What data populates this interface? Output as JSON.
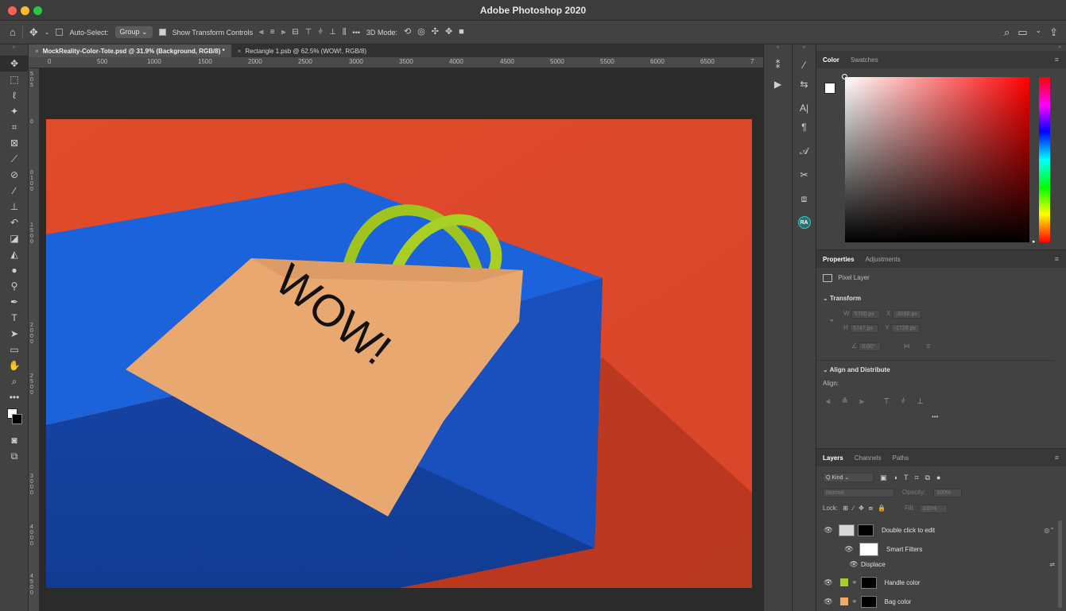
{
  "app": {
    "title": "Adobe Photoshop 2020",
    "traffic_colors": [
      "#fe5f57",
      "#febc2e",
      "#28c840"
    ]
  },
  "options_bar": {
    "auto_select_label": "Auto-Select:",
    "auto_select_value": "Group",
    "show_transform_label": "Show Transform Controls",
    "more_label": "•••",
    "mode_3d_label": "3D Mode:"
  },
  "tools": [
    "move-tool",
    "marquee-tool",
    "lasso-tool",
    "magic-wand-tool",
    "crop-tool",
    "frame-tool",
    "eyedropper-tool",
    "healing-tool",
    "brush-tool",
    "stamp-tool",
    "history-brush-tool",
    "eraser-tool",
    "gradient-tool",
    "blur-tool",
    "dodge-tool",
    "pen-tool",
    "type-tool",
    "path-select-tool",
    "rectangle-tool",
    "hand-tool",
    "zoom-tool",
    "more-tools",
    "fg-bg-color",
    "quick-mask",
    "screen-mode"
  ],
  "doc_tabs": [
    {
      "label": "MockReality-Color-Tote.psd @ 31.9% (Background, RGB/8) *",
      "active": true
    },
    {
      "label": "Rectangle 1.psb @ 62.5% (WOW!, RGB/8)",
      "active": false
    }
  ],
  "ruler_top": [
    "0",
    "500",
    "1000",
    "1500",
    "2000",
    "2500",
    "3000",
    "3500",
    "4000",
    "4500",
    "5000",
    "5500",
    "6000",
    "6500",
    "7"
  ],
  "ruler_left": [
    "5",
    "0",
    "5",
    "0",
    "0",
    "1",
    "0",
    "0",
    "0",
    "1",
    "5",
    "0",
    "0",
    "2",
    "0",
    "0",
    "0",
    "2",
    "5",
    "0",
    "0",
    "3",
    "0",
    "0",
    "0",
    "3",
    "5",
    "0",
    "0",
    "4",
    "0",
    "0",
    "0",
    "4",
    "5",
    "0",
    "0"
  ],
  "canvas": {
    "artwork_text": "WOW!",
    "colors": {
      "background": "#e8532e",
      "box": "#1a55c8",
      "bag": "#e6a46c",
      "handle": "#9ac11e"
    }
  },
  "color_panel": {
    "tabs": [
      "Color",
      "Swatches"
    ],
    "fg_color": "#ffffff",
    "bg_color": "#000000"
  },
  "properties_panel": {
    "tabs": [
      "Properties",
      "Adjustments"
    ],
    "layer_type": "Pixel Layer",
    "transform_header": "Transform",
    "w_label": "W",
    "w_value": "5700 px",
    "x_label": "X",
    "x_value": "-3160 px",
    "h_label": "H",
    "h_value": "5747 px",
    "y_label": "Y",
    "y_value": "-1728 px",
    "angle_value": "0.00°",
    "align_header": "Align and Distribute",
    "align_label": "Align:",
    "more_label": "•••"
  },
  "layers_panel": {
    "tabs": [
      "Layers",
      "Channels",
      "Paths"
    ],
    "filter_label": "Q Kind",
    "blend_mode": "Normal",
    "opacity_label": "Opacity:",
    "opacity_value": "100%",
    "lock_label": "Lock:",
    "fill_label": "Fill:",
    "fill_value": "100%",
    "layers": [
      {
        "name": "Double click to edit"
      },
      {
        "name": "Smart Filters"
      },
      {
        "name": "Displace"
      },
      {
        "name": "Handle color",
        "swatch": "#a6cf2a"
      },
      {
        "name": "Bag color",
        "swatch": "#f3a968"
      }
    ]
  }
}
